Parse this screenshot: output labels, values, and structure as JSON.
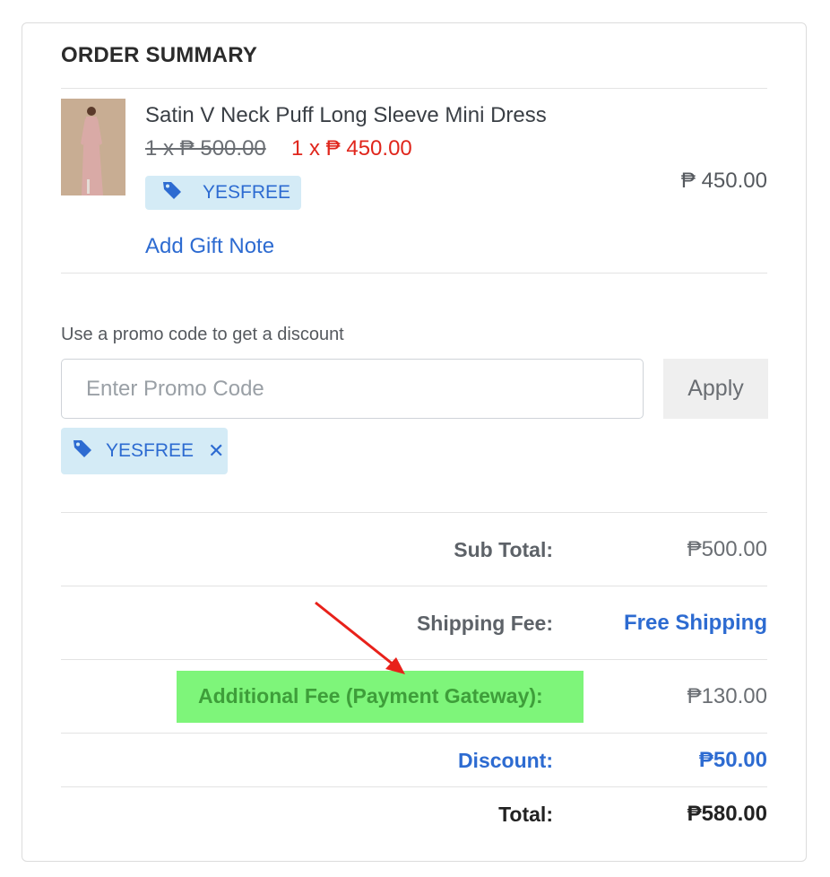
{
  "order": {
    "title": "ORDER SUMMARY",
    "item": {
      "name": "Satin V Neck Puff Long Sleeve Mini Dress",
      "original_price": "1 x ₱ 500.00",
      "sale_price": "1 x ₱ 450.00",
      "line_total": "₱ 450.00",
      "applied_code": "YESFREE",
      "gift_note_link": "Add Gift Note"
    },
    "promo": {
      "label": "Use a promo code to get a discount",
      "placeholder": "Enter Promo Code",
      "apply_label": "Apply",
      "applied_code": "YESFREE",
      "remove_glyph": "✕"
    },
    "totals": {
      "subtotal_label": "Sub Total:",
      "subtotal_value": "₱500.00",
      "shipping_label": "Shipping Fee:",
      "shipping_value": "Free Shipping",
      "fee_label": "Additional Fee (Payment Gateway):",
      "fee_value": "₱130.00",
      "discount_label": "Discount:",
      "discount_value": "₱50.00",
      "total_label": "Total:",
      "total_value": "₱580.00"
    }
  },
  "icons": [
    "tag-icon",
    "close-icon",
    "arrow-annotation"
  ],
  "colors": {
    "accent_blue": "#2d6bd1",
    "sale_red": "#e0261c",
    "highlight_green": "#7ef57a",
    "chip_bg": "#d4ebf6"
  }
}
